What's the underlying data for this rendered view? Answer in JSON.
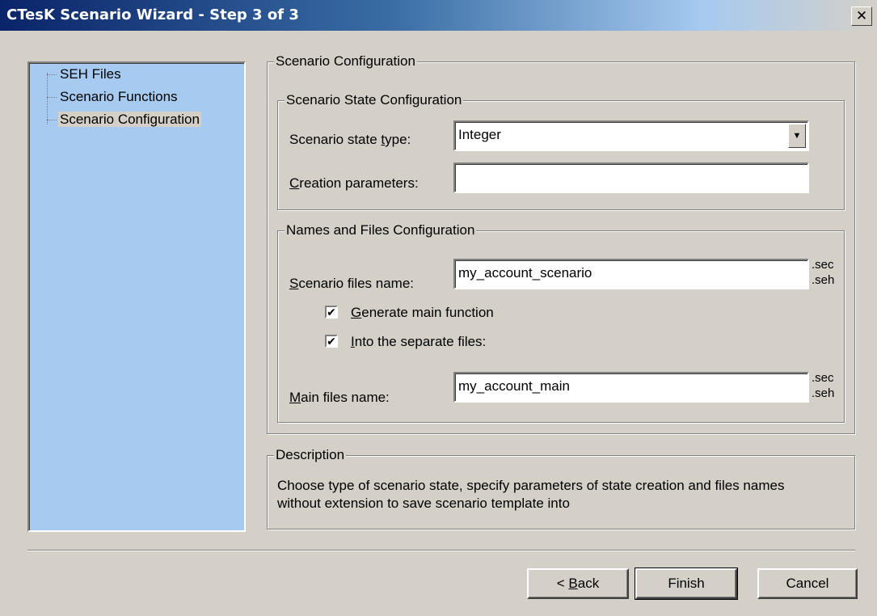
{
  "window": {
    "title": "CTesK Scenario Wizard - Step 3 of 3",
    "close_glyph": "✕"
  },
  "tree": {
    "items": [
      {
        "label": "SEH Files"
      },
      {
        "label": "Scenario Functions"
      },
      {
        "label": "Scenario Configuration",
        "selected": true
      }
    ]
  },
  "scenario_config": {
    "legend": "Scenario Configuration",
    "state_group": {
      "legend": "Scenario State Configuration",
      "state_type_label_pre": "Scenario state ",
      "state_type_label_mn": "t",
      "state_type_label_post": "ype:",
      "state_type_value": "Integer",
      "creation_label_mn": "C",
      "creation_label_post": "reation parameters:",
      "creation_value": ""
    },
    "names_group": {
      "legend": "Names and Files Configuration",
      "scenario_files_label_mn": "S",
      "scenario_files_label_post": "cenario files name:",
      "scenario_files_value": "my_account_scenario",
      "ext1": ".sec",
      "ext2": ".seh",
      "generate_main_mn": "G",
      "generate_main_post": "enerate main function",
      "generate_main_checked": true,
      "separate_files_mn": "I",
      "separate_files_post": "nto the separate files:",
      "separate_files_checked": true,
      "main_files_label_mn": "M",
      "main_files_label_post": "ain files name:",
      "main_files_value": "my_account_main"
    }
  },
  "description": {
    "legend": "Description",
    "line1": "Choose type of scenario state, specify parameters of state creation and files names",
    "line2": "without extension to save scenario template into"
  },
  "buttons": {
    "back_pre": "< ",
    "back_mn": "B",
    "back_post": "ack",
    "finish": "Finish",
    "cancel": "Cancel"
  },
  "icons": {
    "dropdown": "▼",
    "check": "✔"
  },
  "colors": {
    "title_gradient_start": "#0a246a",
    "tree_background": "#a6caf0",
    "dialog_face": "#d4d0c8"
  }
}
